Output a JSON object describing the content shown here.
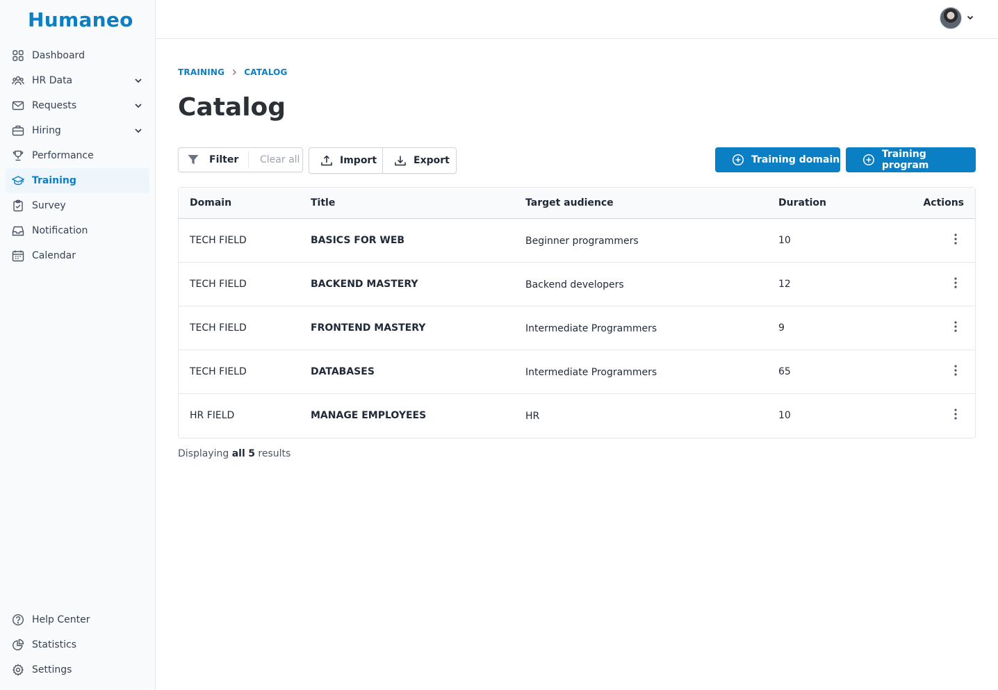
{
  "app": {
    "logo": "Humaneo"
  },
  "sidebar": {
    "items": [
      {
        "label": "Dashboard",
        "icon": "grid-icon",
        "expandable": false,
        "active": false
      },
      {
        "label": "HR Data",
        "icon": "users-icon",
        "expandable": true,
        "active": false
      },
      {
        "label": "Requests",
        "icon": "mail-icon",
        "expandable": true,
        "active": false
      },
      {
        "label": "Hiring",
        "icon": "briefcase-icon",
        "expandable": true,
        "active": false
      },
      {
        "label": "Performance",
        "icon": "trophy-icon",
        "expandable": false,
        "active": false
      },
      {
        "label": "Training",
        "icon": "graduation-cap-icon",
        "expandable": false,
        "active": true
      },
      {
        "label": "Survey",
        "icon": "clipboard-icon",
        "expandable": false,
        "active": false
      },
      {
        "label": "Notification",
        "icon": "inbox-icon",
        "expandable": false,
        "active": false
      },
      {
        "label": "Calendar",
        "icon": "calendar-icon",
        "expandable": false,
        "active": false
      }
    ],
    "bottom_items": [
      {
        "label": "Help Center",
        "icon": "help-icon"
      },
      {
        "label": "Statistics",
        "icon": "pie-chart-icon"
      },
      {
        "label": "Settings",
        "icon": "gear-icon"
      }
    ]
  },
  "breadcrumb": {
    "parent": "TRAINING",
    "current": "CATALOG"
  },
  "page": {
    "title": "Catalog"
  },
  "toolbar": {
    "filter_label": "Filter",
    "clear_label": "Clear all",
    "import_label": "Import",
    "export_label": "Export",
    "add_domain_label": "Training domain",
    "add_program_label": "Training program"
  },
  "table": {
    "columns": [
      "Domain",
      "Title",
      "Target audience",
      "Duration",
      "Actions"
    ],
    "rows": [
      {
        "domain": "TECH FIELD",
        "title": "BASICS FOR WEB",
        "audience": "Beginner programmers",
        "duration": "10"
      },
      {
        "domain": "TECH FIELD",
        "title": "BACKEND MASTERY",
        "audience": "Backend developers",
        "duration": "12"
      },
      {
        "domain": "TECH FIELD",
        "title": "FRONTEND MASTERY",
        "audience": "Intermediate Programmers",
        "duration": "9"
      },
      {
        "domain": "TECH FIELD",
        "title": "DATABASES",
        "audience": "Intermediate Programmers",
        "duration": "65"
      },
      {
        "domain": "HR FIELD",
        "title": "MANAGE EMPLOYEES",
        "audience": "HR",
        "duration": "10"
      }
    ]
  },
  "results": {
    "prefix": "Displaying",
    "all_word": "all",
    "count": "5",
    "suffix": "results"
  },
  "colors": {
    "accent": "#0b7fc3",
    "sidebar_bg": "#f8fafc",
    "active_bg": "#eef5fb"
  }
}
